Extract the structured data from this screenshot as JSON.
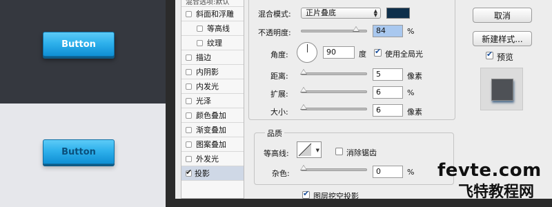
{
  "preview": {
    "button_top_label": "Button",
    "button_bottom_label": "Button"
  },
  "style_list": {
    "header_partial": "混合选项:默认",
    "items": [
      {
        "label": "斜面和浮雕",
        "checked": false,
        "indent": false
      },
      {
        "label": "等高线",
        "checked": false,
        "indent": true
      },
      {
        "label": "纹理",
        "checked": false,
        "indent": true
      },
      {
        "label": "描边",
        "checked": false,
        "indent": false
      },
      {
        "label": "内阴影",
        "checked": false,
        "indent": false
      },
      {
        "label": "内发光",
        "checked": false,
        "indent": false
      },
      {
        "label": "光泽",
        "checked": false,
        "indent": false
      },
      {
        "label": "颜色叠加",
        "checked": false,
        "indent": false
      },
      {
        "label": "渐变叠加",
        "checked": false,
        "indent": false
      },
      {
        "label": "图案叠加",
        "checked": false,
        "indent": false
      },
      {
        "label": "外发光",
        "checked": false,
        "indent": false
      },
      {
        "label": "投影",
        "checked": true,
        "indent": false
      }
    ]
  },
  "structure": {
    "blend_mode_label": "混合模式:",
    "blend_mode_value": "正片叠底",
    "shadow_color": "#0e2f4b",
    "opacity_label": "不透明度:",
    "opacity_value": "84",
    "opacity_unit": "%",
    "opacity_level_pct": 84,
    "angle_label": "角度:",
    "angle_value": "90",
    "angle_unit": "度",
    "global_light_label": "使用全局光",
    "distance_label": "距离:",
    "distance_value": "5",
    "distance_unit": "像素",
    "spread_label": "扩展:",
    "spread_value": "6",
    "spread_unit": "%",
    "size_label": "大小:",
    "size_value": "6",
    "size_unit": "像素"
  },
  "quality": {
    "title": "品质",
    "contour_label": "等高线:",
    "antialias_label": "消除锯齿",
    "noise_label": "杂色:",
    "noise_value": "0",
    "noise_unit": "%",
    "knockout_label": "图层挖空投影"
  },
  "actions": {
    "cancel_label": "取消",
    "new_style_label": "新建样式...",
    "preview_label": "预览"
  },
  "watermark": {
    "line1": "fevte.com",
    "line2": "飞特教程网"
  }
}
